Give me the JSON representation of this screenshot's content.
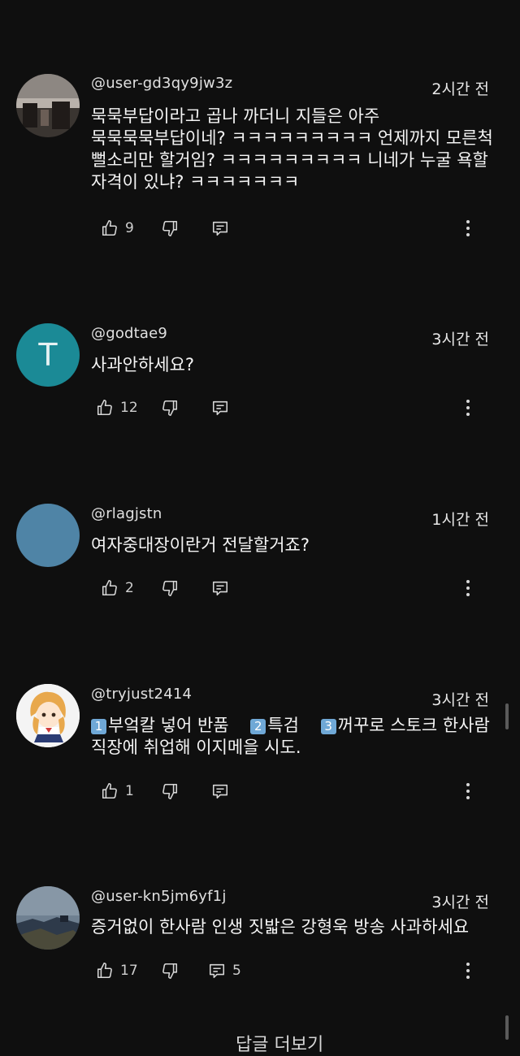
{
  "comments": [
    {
      "handle": "@user-gd3qy9jw3z",
      "time": "2시간 전",
      "text": "묵묵부답이라고 곱나 까더니 지들은 아주 묵묵묵묵부답이네? ㅋㅋㅋㅋㅋㅋㅋㅋㅋ 언제까지 모른척 뻘소리만 할거임? ㅋㅋㅋㅋㅋㅋㅋㅋㅋ 니네가 누굴 욕할 자격이 있냐? ㅋㅋㅋㅋㅋㅋㅋ",
      "likes": "9",
      "replies": "",
      "avatar": {
        "type": "photo",
        "colors": [
          "#2a2624",
          "#6b5e56",
          "#b9b2ab"
        ]
      }
    },
    {
      "handle": "@godtae9",
      "time": "3시간 전",
      "text": "사과안하세요?",
      "likes": "12",
      "replies": "",
      "avatar": {
        "type": "letter",
        "letter": "T",
        "color": "#1b8a96"
      }
    },
    {
      "handle": "@rlagjstn",
      "time": "1시간 전",
      "text": "여자중대장이란거 전달할거죠?",
      "likes": "2",
      "replies": "",
      "avatar": {
        "type": "plain",
        "color": "#4f84a6"
      }
    },
    {
      "handle": "@tryjust2414",
      "time": "3시간 전",
      "text_parts": [
        {
          "num": "1",
          "text": "부엌칼 넣어 반품"
        },
        {
          "num": "2",
          "text": "특검"
        },
        {
          "num": "3",
          "text": "꺼꾸로 스토크 한사람 직장에 취업해 이지메을 시도."
        }
      ],
      "likes": "1",
      "replies": "",
      "avatar": {
        "type": "anime",
        "colors": [
          "#f2f2f2",
          "#e8a84c",
          "#2b3c74"
        ]
      }
    },
    {
      "handle": "@user-kn5jm6yf1j",
      "time": "3시간 전",
      "text": "증거없이 한사람 인생 짓밟은 강형욱 방송 사과하세요",
      "likes": "17",
      "replies": "5",
      "avatar": {
        "type": "photo",
        "colors": [
          "#2e3a4a",
          "#8797a6",
          "#4b4a3a"
        ]
      }
    }
  ],
  "icons": {
    "like": "thumbs-up-icon",
    "dislike": "thumbs-down-icon",
    "reply": "reply-icon",
    "more": "more-vertical-icon"
  },
  "bottom_partial": "답글 더보기"
}
